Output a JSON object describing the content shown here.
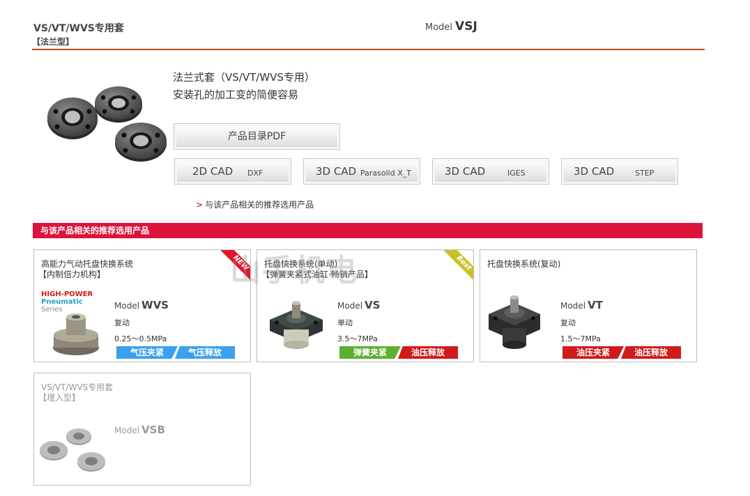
{
  "header": {
    "title": "VS/VT/WVS专用套",
    "subtitle": "【法兰型】",
    "model_prefix": "Model",
    "model_name": "VSJ"
  },
  "hero": {
    "line1": "法兰式套（VS/VT/WVS专用）",
    "line2": "安装孔的加工变的简便容易",
    "pdf_button": "产品目录PDF",
    "cad_buttons": [
      {
        "big": "2D CAD",
        "small": "DXF"
      },
      {
        "big": "3D CAD",
        "small": "Parasolid X_T"
      },
      {
        "big": "3D CAD",
        "small": "IGES"
      },
      {
        "big": "3D CAD",
        "small": "STEP"
      }
    ],
    "related_link_arrow": ">",
    "related_link": "与该产品相关的推荐选用产品"
  },
  "section_title": "与该产品相关的推荐选用产品",
  "watermark": "山手机电",
  "cards": [
    {
      "title": "高能力气动托盘快换系统",
      "subtitle": "【内制倍力机构】",
      "model_prefix": "Model",
      "model": "WVS",
      "spec1": "复动",
      "spec2": "0.25～0.5MPa",
      "tag_a": "气压夹紧",
      "tag_b": "气压释放",
      "ribbon": "NEW",
      "logo": {
        "l1": "HIGH-POWER",
        "l2": "Pneumatic",
        "l3": "Series"
      }
    },
    {
      "title": "托盘快换系统(单动)",
      "subtitle": "【弹簧夹紧式油缸·畅销产品】",
      "model_prefix": "Model",
      "model": "VS",
      "spec1": "单动",
      "spec2": "3.5～7MPa",
      "tag_a": "弹簧夹紧",
      "tag_b": "油压释放",
      "ribbon": "Best"
    },
    {
      "title": "托盘快换系统(复动)",
      "model_prefix": "Model",
      "model": "VT",
      "spec1": "复动",
      "spec2": "1.5～7MPa",
      "tag_a": "油压夹紧",
      "tag_b": "油压释放"
    },
    {
      "title": "VS/VT/WVS专用套",
      "subtitle": "【埋入型】",
      "model_prefix": "Model",
      "model": "VSB"
    }
  ],
  "colors": {
    "header_rule": "#c0461f",
    "section_bar": "#dc143c",
    "tag_blue": "#3aa0f0",
    "tag_green": "#5bb030",
    "tag_red": "#d11a1a"
  }
}
